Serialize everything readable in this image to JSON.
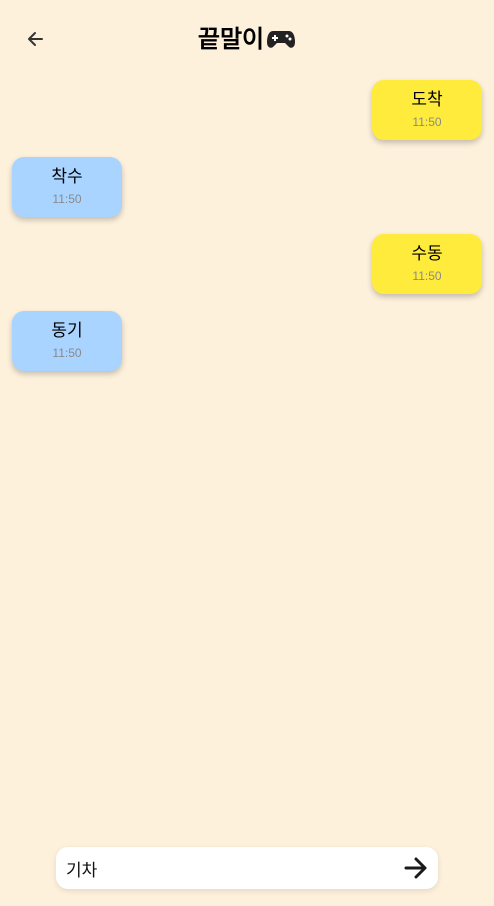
{
  "header": {
    "title": "끝말이",
    "title_icon": "gamepad-icon",
    "back_icon": "arrow-left-icon"
  },
  "messages": [
    {
      "sender": "me",
      "text": "도착",
      "time": "11:50"
    },
    {
      "sender": "other",
      "text": "착수",
      "time": "11:50"
    },
    {
      "sender": "me",
      "text": "수동",
      "time": "11:50"
    },
    {
      "sender": "other",
      "text": "동기",
      "time": "11:50"
    }
  ],
  "composer": {
    "value": "기차",
    "send_icon": "arrow-right-icon"
  },
  "colors": {
    "background": "#FDF1DC",
    "my_bubble": "#FFEB3B",
    "other_bubble": "#A8D4FF",
    "time_text": "#8a8a8a"
  }
}
